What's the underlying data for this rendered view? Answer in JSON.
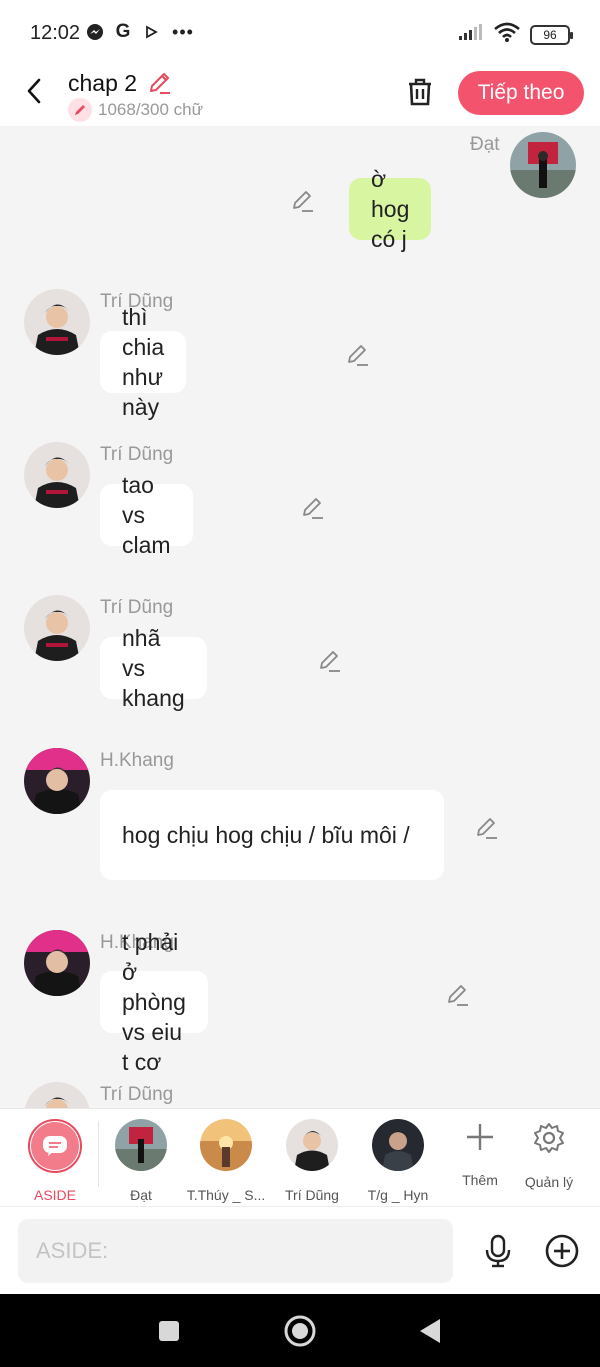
{
  "status": {
    "time": "12:02",
    "battery": "96"
  },
  "header": {
    "title": "chap 2",
    "word_count": "1068/300 chữ",
    "next_label": "Tiếp theo"
  },
  "messages": [
    {
      "sender": "Đạt",
      "text": "ờ hog có j",
      "self": true
    },
    {
      "sender": "Trí Dũng",
      "text": "thì chia như này"
    },
    {
      "sender": "Trí Dũng",
      "text": "tao vs clam"
    },
    {
      "sender": "Trí Dũng",
      "text": "nhã vs khang"
    },
    {
      "sender": "H.Khang",
      "text": "hog chịu hog chịu / bĩu môi /"
    },
    {
      "sender": "H.Khang",
      "text": "t phải ở phòng vs eiu t cơ"
    },
    {
      "sender": "Trí Dũng",
      "text": ""
    }
  ],
  "characters": [
    {
      "label": "ASIDE"
    },
    {
      "label": "Đạt"
    },
    {
      "label": "T.Thúy _ S..."
    },
    {
      "label": "Trí Dũng"
    },
    {
      "label": "T/g _ Hyn"
    }
  ],
  "tools": {
    "add_label": "Thêm",
    "manage_label": "Quản lý"
  },
  "input": {
    "placeholder": "ASIDE:",
    "value": ""
  },
  "colors": {
    "accent": "#f4536d",
    "self_bubble": "#d8f5a2",
    "background": "#f4f4f4"
  }
}
